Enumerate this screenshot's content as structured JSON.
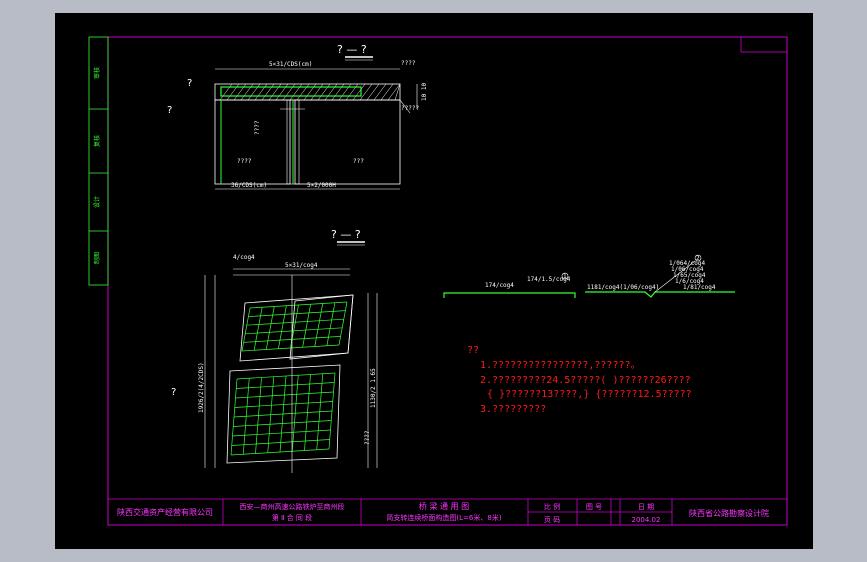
{
  "colors": {
    "background": "#000000",
    "frame": "#cc00cc",
    "rebar": "#33ff33",
    "notes": "#ff1a1a",
    "lines": "#ffffff",
    "outer": "#b7bcc7"
  },
  "drawing": {
    "section_title": "? — ?",
    "plan_title": "? — ?",
    "section": {
      "top_dim": "5×31/CDS(cm)",
      "bottom_dim": "36/CDS(cm)",
      "bottom_dim2": "5×2/000H",
      "label_q1": "????",
      "label_q2": "?????",
      "label_q3": "????",
      "label_q4": "????",
      "label_q5": "???",
      "label_q6": "?",
      "label_q7": "?",
      "right_dim": "10 10"
    },
    "plan": {
      "top_dim": "5×31/cog4",
      "top_dim2": "4/cog4",
      "left_dim": "1926/2(4/2CDS)",
      "right_dim": "1130/2 1.65",
      "label_q": "?",
      "label_q2": "????"
    },
    "detail1": {
      "label_a": "174/cog4",
      "label_b": "174/1.5/cog4",
      "marker": "1"
    },
    "detail2": {
      "label_a": "1181/cog4(1/06/cog4)",
      "label_b": "1/81/cog4",
      "label_c": "1/064/cog4",
      "label_d": "1/06/cog4",
      "label_e": "1/65/cog4",
      "label_f": "1/6/cog4",
      "marker": "2"
    }
  },
  "notes": {
    "heading": "??",
    "line1": "1.????????????????,??????。",
    "line2": "2.?????????24.5?????(  )??????26????",
    "line3": "{  }??????13????,}  {??????12.5?????",
    "line4": "3.?????????"
  },
  "side_tabs": [
    "审核",
    "复核",
    "设计",
    "制图"
  ],
  "title_block": {
    "company": "陕西交通资产经营有限公司",
    "project_line1": "西安—商州高速公路铁炉至商州段",
    "project_line2": "第 Ⅱ 合 同 段",
    "drawing_name_line1": "桥 梁 通 用 图",
    "drawing_name_line2": "简支转连续桥面构造图(L=6米、8米)",
    "labels": {
      "scale": "比 例",
      "sheet_no": "图 号",
      "date": "日 期",
      "sheet": "页 码"
    },
    "date_value": "2004.02",
    "designer": "陕西省公路勘察设计院"
  }
}
